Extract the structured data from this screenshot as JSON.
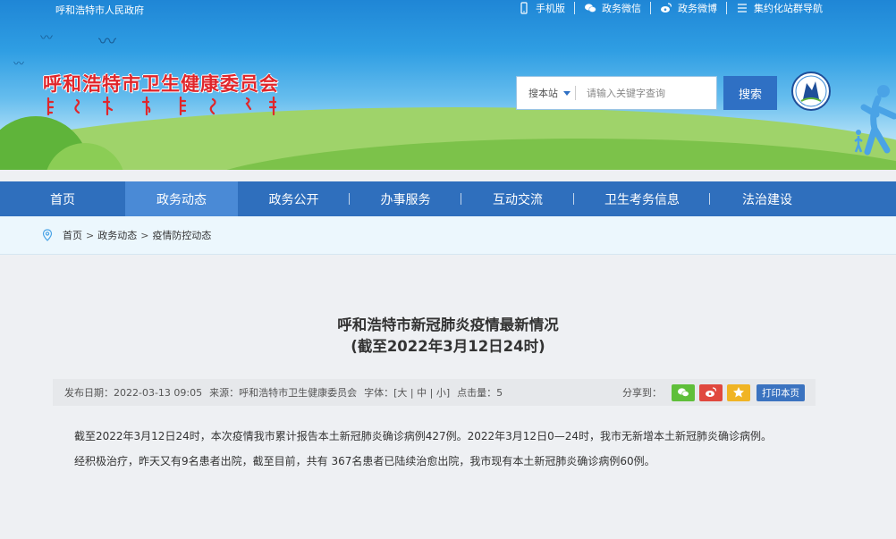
{
  "header": {
    "gov_link": "呼和浩特市人民政府",
    "top_links": [
      {
        "label": "手机版",
        "icon": "mobile-icon"
      },
      {
        "label": "政务微信",
        "icon": "wechat-icon"
      },
      {
        "label": "政务微博",
        "icon": "weibo-icon"
      },
      {
        "label": "集约化站群导航",
        "icon": "list-icon"
      }
    ],
    "site_title": "呼和浩特市卫生健康委员会"
  },
  "search": {
    "scope_label": "搜本站",
    "placeholder": "请输入关键字查询",
    "button_label": "搜索"
  },
  "nav": {
    "items": [
      "首页",
      "政务动态",
      "政务公开",
      "办事服务",
      "互动交流",
      "卫生考务信息",
      "法治建设"
    ],
    "active_index": 1
  },
  "breadcrumb": {
    "items": [
      "首页",
      "政务动态",
      "疫情防控动态"
    ],
    "separator": ">"
  },
  "article": {
    "title_line1": "呼和浩特市新冠肺炎疫情最新情况",
    "title_line2": "(截至2022年3月12日24时)",
    "meta": {
      "date": "发布日期：2022-03-13 09:05",
      "source": "来源：呼和浩特市卫生健康委员会",
      "font_size": "字体：[大 | 中 | 小]",
      "clicks": "点击量：5"
    },
    "share_label": "分享到：",
    "print_label": "打印本页",
    "paragraphs": [
      "截至2022年3月12日24时，本次疫情我市累计报告本土新冠肺炎确诊病例427例。2022年3月12日0—24时，我市无新增本土新冠肺炎确诊病例。",
      "经积极治疗，昨天又有9名患者出院，截至目前，共有 367名患者已陆续治愈出院，我市现有本土新冠肺炎确诊病例60例。"
    ]
  },
  "colors": {
    "nav_bg": "#2f6fbd",
    "nav_active": "#4a8ad6",
    "title_red": "#e0262b",
    "search_button": "#2f70c4",
    "wechat_green": "#5fbf3a",
    "weibo_red": "#e0483e",
    "fav_yellow": "#f0b424",
    "print_blue": "#3b73c0"
  }
}
